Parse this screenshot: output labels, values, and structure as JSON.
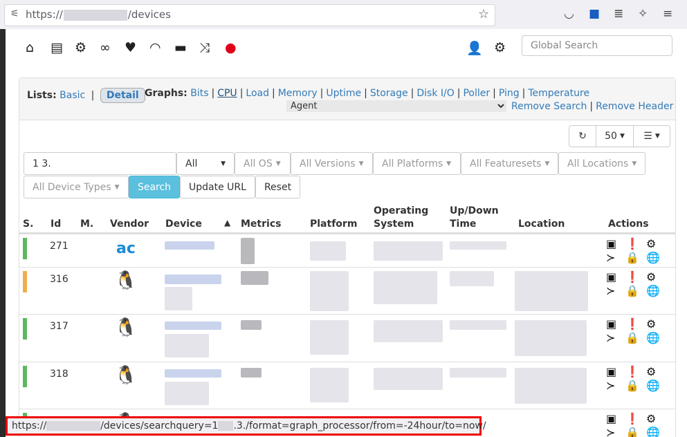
{
  "browser": {
    "url_prefix": "https://",
    "url_suffix": "/devices",
    "icons": [
      "bookmark-star-icon",
      "pocket-icon",
      "shield-extension-icon",
      "library-icon",
      "extensions-icon",
      "menu-icon"
    ]
  },
  "nav": {
    "icons": [
      "home-icon",
      "server-icon",
      "cogs-icon",
      "link-icon",
      "heartbeat-icon",
      "wifi-icon",
      "hdd-icon",
      "random-icon",
      "alert-icon",
      "user-icon",
      "settings-icon"
    ],
    "global_search_placeholder": "Global Search"
  },
  "lists": {
    "label": "Lists:",
    "basic": "Basic",
    "detail": "Detail",
    "graphs_label": "Graphs:",
    "graphs": [
      "Bits",
      "CPU",
      "Load",
      "Memory",
      "Uptime",
      "Storage",
      "Disk I/O",
      "Poller",
      "Ping",
      "Temperature"
    ],
    "agent_value": "Agent",
    "remove_search": "Remove Search",
    "remove_header": "Remove Header"
  },
  "toolbar": {
    "page_size": "50"
  },
  "filters": {
    "search_value": "1     3.",
    "status": "All",
    "os": "All OS",
    "versions": "All Versions",
    "platforms": "All Platforms",
    "featuresets": "All Featuresets",
    "locations": "All Locations",
    "device_types": "All Device Types",
    "search_btn": "Search",
    "update_url_btn": "Update URL",
    "reset_btn": "Reset"
  },
  "table": {
    "headers": {
      "status": "S.",
      "id": "Id",
      "maint": "M.",
      "vendor": "Vendor",
      "device": "Device",
      "metrics": "Metrics",
      "platform": "Platform",
      "os_line1": "Operating",
      "os_line2": "System",
      "uptime_line1": "Up/Down",
      "uptime_line2": "Time",
      "location": "Location",
      "actions": "Actions"
    },
    "rows": [
      {
        "id": "271",
        "status_color": "#5cb85c",
        "vendor": "ac-logo"
      },
      {
        "id": "316",
        "status_color": "#f0ad4e",
        "vendor": "linux"
      },
      {
        "id": "317",
        "status_color": "#5cb85c",
        "vendor": "linux"
      },
      {
        "id": "318",
        "status_color": "#5cb85c",
        "vendor": "linux"
      }
    ]
  },
  "statusbar": {
    "url_part1": "https://",
    "url_part2": "/devices/searchquery=1",
    "url_part3": ".3./format=graph_processor/from=-24hour/to=now/"
  }
}
